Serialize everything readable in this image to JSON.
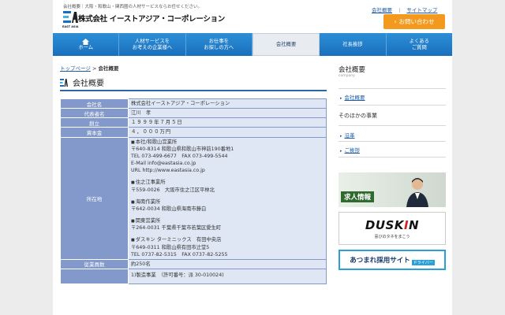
{
  "header": {
    "tagline": "会社概要｜大阪・和歌山・関西圏の人材サービスならお任せください。",
    "company_name": "株式会社 イーストアジア・コーポレーション",
    "logo_sub": "EAST ASIA",
    "links": [
      {
        "label": "会社概要"
      },
      {
        "label": "サイトマップ"
      }
    ],
    "contact_button": "お問い合わせ"
  },
  "nav": {
    "items": [
      {
        "lines": [
          "",
          "ホーム"
        ],
        "icon": "home-icon"
      },
      {
        "lines": [
          "人材サービスを",
          "お考えの企業様へ"
        ]
      },
      {
        "lines": [
          "お仕事を",
          "お探しの方へ"
        ]
      },
      {
        "lines": [
          "会社概要",
          ""
        ]
      },
      {
        "lines": [
          "社長挨拶",
          ""
        ]
      },
      {
        "lines": [
          "よくある",
          "ご質問"
        ]
      }
    ]
  },
  "breadcrumb": {
    "home": "トップページ",
    "sep": " > ",
    "current": "会社概要"
  },
  "page_title": "会社概要",
  "table": {
    "company_label": "会社名",
    "company_value": "株式会社イーストアジア・コーポレーション",
    "rep_label": "代表者名",
    "rep_value": "江川　孝",
    "est_label": "創立",
    "est_value": "１９９９年７月５日",
    "capital_label": "資本金",
    "capital_value": "４，０００万円",
    "address_label": "所在地",
    "offices": [
      {
        "name": "本社/和歌山営業所",
        "lines": [
          "〒640-8314 和歌山県和歌山市神前190番地1",
          "TEL 073-499-6677　FAX 073-499-5544",
          "E-Mail info@eastasia.co.jp",
          "URL http://www.eastasia.co.jp"
        ]
      },
      {
        "name": "住之江事業所",
        "lines": [
          "〒559-0026　大阪市住之江区平林北"
        ]
      },
      {
        "name": "海南作業所",
        "lines": [
          "〒642-0034 和歌山県海南市藤白"
        ]
      },
      {
        "name": "関東営業所",
        "lines": [
          "〒264-0031 千葉県千葉市若葉区愛生町"
        ]
      },
      {
        "name": "ダスキン ターミニックス　有田中央店",
        "lines": [
          "〒649-0311 和歌山県有田市辻堂5",
          "TEL 0737-82-5315　FAX 0737-82-5255"
        ]
      }
    ],
    "employees_label": "従業員数",
    "employees_value": "約250名",
    "business_value": "1)製造事業　（許可番号：派 30-010024)"
  },
  "sidebar": {
    "title": "会社概要",
    "subtitle": "company",
    "link_main": "会社概要",
    "other_heading": "そのほかの事業",
    "links": [
      "沿革",
      "ご挨拶"
    ]
  },
  "banners": {
    "recruit": "求人情報",
    "duskin_pre": "DUSK",
    "duskin_i": "I",
    "duskin_post": "N",
    "duskin_slogan": "喜びのタネをまこう",
    "atsumare": "あつまれ採用サイト",
    "atsumare_sub": "ドライバー"
  },
  "colors": {
    "nav_blue": "#1a6fbd",
    "accent_orange": "#f39a1e",
    "table_header": "#8399cb",
    "table_cell": "#dfe7f5",
    "link": "#1a5aa6"
  }
}
